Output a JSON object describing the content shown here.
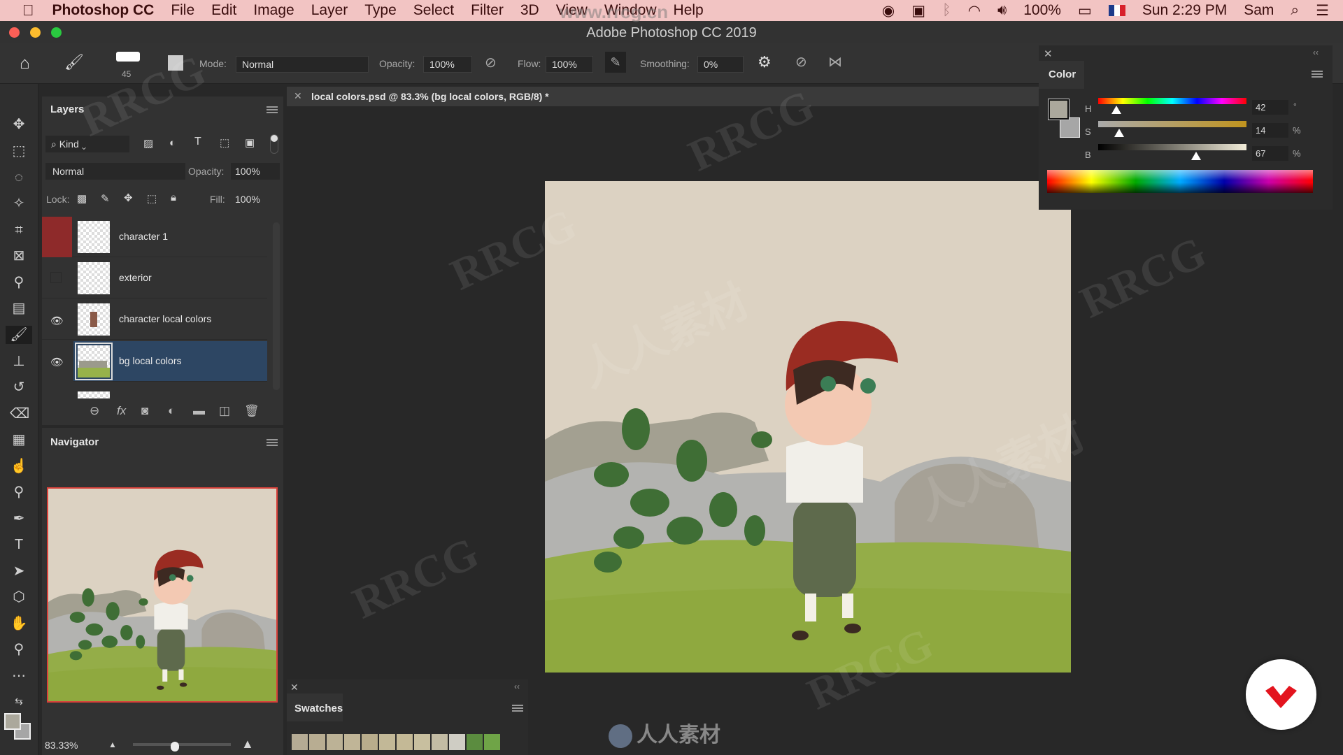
{
  "menubar": {
    "app": "Photoshop CC",
    "items": [
      "File",
      "Edit",
      "Image",
      "Layer",
      "Type",
      "Select",
      "Filter",
      "3D",
      "View",
      "Window",
      "Help"
    ],
    "battery": "100%",
    "clock": "Sun 2:29 PM",
    "user": "Sam"
  },
  "window": {
    "title": "Adobe Photoshop CC 2019"
  },
  "options": {
    "brush_size": "45",
    "mode_label": "Mode:",
    "mode": "Normal",
    "opacity_label": "Opacity:",
    "opacity": "100%",
    "flow_label": "Flow:",
    "flow": "100%",
    "smoothing_label": "Smoothing:",
    "smoothing": "0%"
  },
  "layers": {
    "title": "Layers",
    "filter": "Kind",
    "blend": "Normal",
    "opacity_label": "Opacity:",
    "opacity": "100%",
    "lock_label": "Lock:",
    "fill_label": "Fill:",
    "fill": "100%",
    "items": [
      {
        "name": "character 1",
        "visible": false
      },
      {
        "name": "exterior",
        "visible": false
      },
      {
        "name": "character local colors",
        "visible": true
      },
      {
        "name": "bg local colors",
        "visible": true,
        "selected": true
      }
    ]
  },
  "navigator": {
    "title": "Navigator",
    "zoom": "83.33%"
  },
  "document": {
    "tab": "local colors.psd @ 83.3% (bg local colors, RGB/8) *"
  },
  "color": {
    "title": "Color",
    "h": "42",
    "s": "14",
    "b": "67",
    "h_unit": "°",
    "s_unit": "%",
    "b_unit": "%",
    "foreground": "#aba89c",
    "background": "#a6a6a6"
  },
  "swatches": {
    "title": "Swatches",
    "colors": [
      "#b5ab94",
      "#b8ad92",
      "#bcb296",
      "#c0b597",
      "#b9ad8c",
      "#c2b897",
      "#c4b996",
      "#c8bf9f",
      "#c3bca4",
      "#cfcdc4",
      "#5b8c3f",
      "#6fa447"
    ]
  },
  "watermark": {
    "site": "www.rrcg.cn",
    "brand": "RRCG",
    "cn": "人人素材",
    "bottom": "人人素材"
  }
}
